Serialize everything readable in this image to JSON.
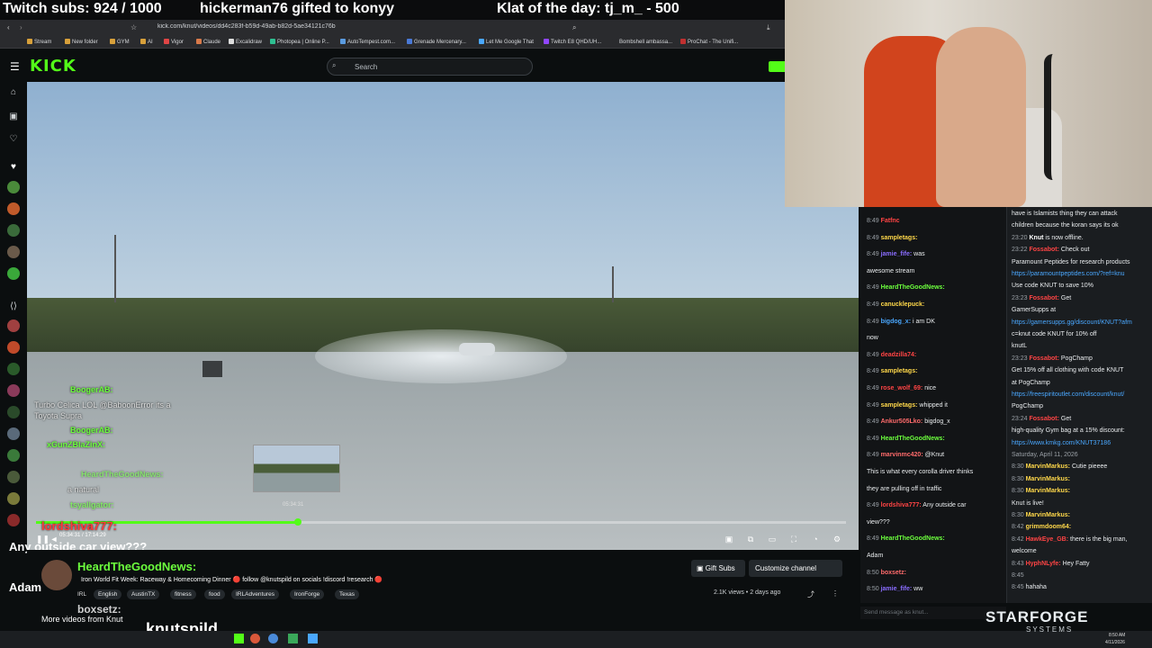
{
  "overlay": {
    "subs": "Twitch subs: 924 / 1000",
    "gift": "hickerman76 gifted to konyy",
    "klat": "Klat of the day: tj_m_ - 500"
  },
  "browser": {
    "url": "kick.com/knut/videos/dd4c283f-b59d-49ab-b82d-5ae34121c76b",
    "bookmarks": [
      "Stream",
      "New folder",
      "GYM",
      "AI",
      "Vigor",
      "Claude",
      "Excalidraw",
      "Photopea | Online P...",
      "AutoTempest.com...",
      "Grenade Mercenary...",
      "Let Me Google That",
      "Twitch E8 QHD/UH...",
      "Bombshell ambassa...",
      "ProChat - The Unifi..."
    ]
  },
  "kick": {
    "logo": "KICK",
    "search_placeholder": "Search"
  },
  "video": {
    "current_time": "05:34:31 / 17:14:29",
    "hover_time": "05:34:31",
    "progress": 0.323
  },
  "overlay_chat": {
    "lines": [
      {
        "user": "BoogerAB:",
        "text": ""
      },
      {
        "user": "",
        "text": "Turbo Celica LOL @BaboonError its a"
      },
      {
        "user": "",
        "text": "Toyota Supra"
      },
      {
        "user": "BoogerAB:",
        "text": ""
      },
      {
        "user": "xGunZBlaZinX:",
        "text": ""
      },
      {
        "user": "HeardTheGoodNews:",
        "text": ""
      },
      {
        "user": "",
        "text": "a natural"
      },
      {
        "user": "tsyallgator:",
        "text": ""
      }
    ],
    "lordshiva": "lordshiva777:",
    "big_message": "Any outside car view???",
    "adam": "Adam",
    "boxsetz": "boxsetz:",
    "more_videos": "More videos from Knut",
    "knutspild": "knutspild"
  },
  "stream_info": {
    "streamer": "HeardTheGoodNews:",
    "title": "Iron World Fit Week: Raceway & Homecoming Dinner 🔴 follow @knutspild on socials !discord !research 🔴",
    "tags": [
      "IRL",
      "English",
      "AustinTX",
      "fitness",
      "food",
      "IRLAdventures",
      "IronForge",
      "Texas"
    ],
    "views": "2.1K views • 2 days ago",
    "gift_subs": "Gift Subs",
    "customize": "Customize channel"
  },
  "chat_a": [
    {
      "t": "8:49",
      "u": "Fatfnc",
      "c": "#ff4444",
      "m": ""
    },
    {
      "t": "8:49",
      "u": "sampletags:",
      "c": "#ffd84a",
      "m": ""
    },
    {
      "t": "8:49",
      "u": "jamie_fife:",
      "c": "#8a6dff",
      "m": "was"
    },
    {
      "t": "",
      "u": "",
      "c": "",
      "m": "awesome stream"
    },
    {
      "t": "8:49",
      "u": "HeardTheGoodNews:",
      "c": "#6cff3d",
      "m": ""
    },
    {
      "t": "8:49",
      "u": "canucklepuck:",
      "c": "#ffd84a",
      "m": ""
    },
    {
      "t": "8:49",
      "u": "bigdog_x:",
      "c": "#4aa8ff",
      "m": "i am DK"
    },
    {
      "t": "",
      "u": "",
      "c": "",
      "m": "now"
    },
    {
      "t": "8:49",
      "u": "deadzilla74:",
      "c": "#ff4444",
      "m": ""
    },
    {
      "t": "8:49",
      "u": "sampletags:",
      "c": "#ffd84a",
      "m": ""
    },
    {
      "t": "8:49",
      "u": "rose_wolf_69:",
      "c": "#ff4444",
      "m": "nice"
    },
    {
      "t": "8:49",
      "u": "sampletags:",
      "c": "#ffd84a",
      "m": "whipped it"
    },
    {
      "t": "8:49",
      "u": "Ankur505Lko:",
      "c": "#ff6b6b",
      "m": "bigdog_x"
    },
    {
      "t": "8:49",
      "u": "HeardTheGoodNews:",
      "c": "#6cff3d",
      "m": ""
    },
    {
      "t": "8:49",
      "u": "marvinmc420:",
      "c": "#ff6b6b",
      "m": "@Knut"
    },
    {
      "t": "",
      "u": "",
      "c": "",
      "m": "This is what every corolla driver thinks"
    },
    {
      "t": "",
      "u": "",
      "c": "",
      "m": "they are pulling off in traffic"
    },
    {
      "t": "8:49",
      "u": "lordshiva777:",
      "c": "#ff4444",
      "m": "Any outside car"
    },
    {
      "t": "",
      "u": "",
      "c": "",
      "m": "view???"
    },
    {
      "t": "8:49",
      "u": "HeardTheGoodNews:",
      "c": "#6cff3d",
      "m": ""
    },
    {
      "t": "",
      "u": "",
      "c": "",
      "m": "Adam"
    },
    {
      "t": "8:50",
      "u": "boxsetz:",
      "c": "#ff6b6b",
      "m": ""
    },
    {
      "t": "8:50",
      "u": "jamie_fife:",
      "c": "#8a6dff",
      "m": "ww"
    }
  ],
  "chat_b": [
    {
      "t": "",
      "u": "",
      "c": "",
      "m": "have is Islamists thing they can attack"
    },
    {
      "t": "",
      "u": "",
      "c": "",
      "m": "children because the koran says its ok"
    },
    {
      "t": "23:20",
      "u": "Knut",
      "c": "#fff",
      "m": "is now offline."
    },
    {
      "t": "23:22",
      "u": "Fossabot:",
      "c": "#ff4444",
      "m": "Check out"
    },
    {
      "t": "",
      "u": "",
      "c": "",
      "m": "Paramount Peptides for research products"
    },
    {
      "t": "",
      "u": "",
      "c": "#4aa8ff",
      "m": "https://paramountpeptides.com/?ref=knu"
    },
    {
      "t": "",
      "u": "",
      "c": "",
      "m": "Use code KNUT to save 10%"
    },
    {
      "t": "23:23",
      "u": "Fossabot:",
      "c": "#ff4444",
      "m": "Get"
    },
    {
      "t": "",
      "u": "",
      "c": "",
      "m": "GamerSupps at"
    },
    {
      "t": "",
      "u": "",
      "c": "#4aa8ff",
      "m": "https://gamersupps.gg/discount/KNUT?afm"
    },
    {
      "t": "",
      "u": "",
      "c": "",
      "m": "c=knut   code KNUT for 10% off"
    },
    {
      "t": "",
      "u": "",
      "c": "",
      "m": "knutL"
    },
    {
      "t": "23:23",
      "u": "Fossabot:",
      "c": "#ff4444",
      "m": "PogChamp"
    },
    {
      "t": "",
      "u": "",
      "c": "",
      "m": "Get 15% off all clothing with code KNUT"
    },
    {
      "t": "",
      "u": "",
      "c": "",
      "m": "at PogChamp"
    },
    {
      "t": "",
      "u": "",
      "c": "#4aa8ff",
      "m": "https://freespiritoutlet.com/discount/knut/"
    },
    {
      "t": "",
      "u": "",
      "c": "",
      "m": "PogChamp"
    },
    {
      "t": "23:24",
      "u": "Fossabot:",
      "c": "#ff4444",
      "m": "Get"
    },
    {
      "t": "",
      "u": "",
      "c": "",
      "m": "high-quality Gym bag at a 15% discount:"
    },
    {
      "t": "",
      "u": "",
      "c": "#4aa8ff",
      "m": "https://www.kmkg.com/KNUT37186"
    },
    {
      "t": "",
      "u": "",
      "c": "#9aa0a6",
      "m": "Saturday, April 11, 2026"
    },
    {
      "t": "8:30",
      "u": "MarvinMarkus:",
      "c": "#ffd84a",
      "m": "Cutie pieeee"
    },
    {
      "t": "8:30",
      "u": "MarvinMarkus:",
      "c": "#ffd84a",
      "m": ""
    },
    {
      "t": "8:30",
      "u": "MarvinMarkus:",
      "c": "#ffd84a",
      "m": ""
    },
    {
      "t": "",
      "u": "",
      "c": "",
      "m": "Knut is live!"
    },
    {
      "t": "8:30",
      "u": "MarvinMarkus:",
      "c": "#ffd84a",
      "m": ""
    },
    {
      "t": "8:42",
      "u": "grimmdoom64:",
      "c": "#ffd84a",
      "m": ""
    },
    {
      "t": "8:42",
      "u": "HawkEye_GB:",
      "c": "#ff4444",
      "m": "there is the big man,"
    },
    {
      "t": "",
      "u": "",
      "c": "",
      "m": "welcome"
    },
    {
      "t": "8:43",
      "u": "HyphNLyfe:",
      "c": "#ff4444",
      "m": "Hey Fatty"
    },
    {
      "t": "8:45",
      "u": "",
      "c": "",
      "m": ""
    },
    {
      "t": "8:45",
      "u": "",
      "c": "",
      "m": "hahaha"
    }
  ],
  "chat_input_placeholder": "Send message as knut...",
  "sponsor": {
    "name": "STARFORGE",
    "sub": "SYSTEMS"
  },
  "taskbar": {
    "time": "8:50 AM",
    "date": "4/11/2026"
  }
}
